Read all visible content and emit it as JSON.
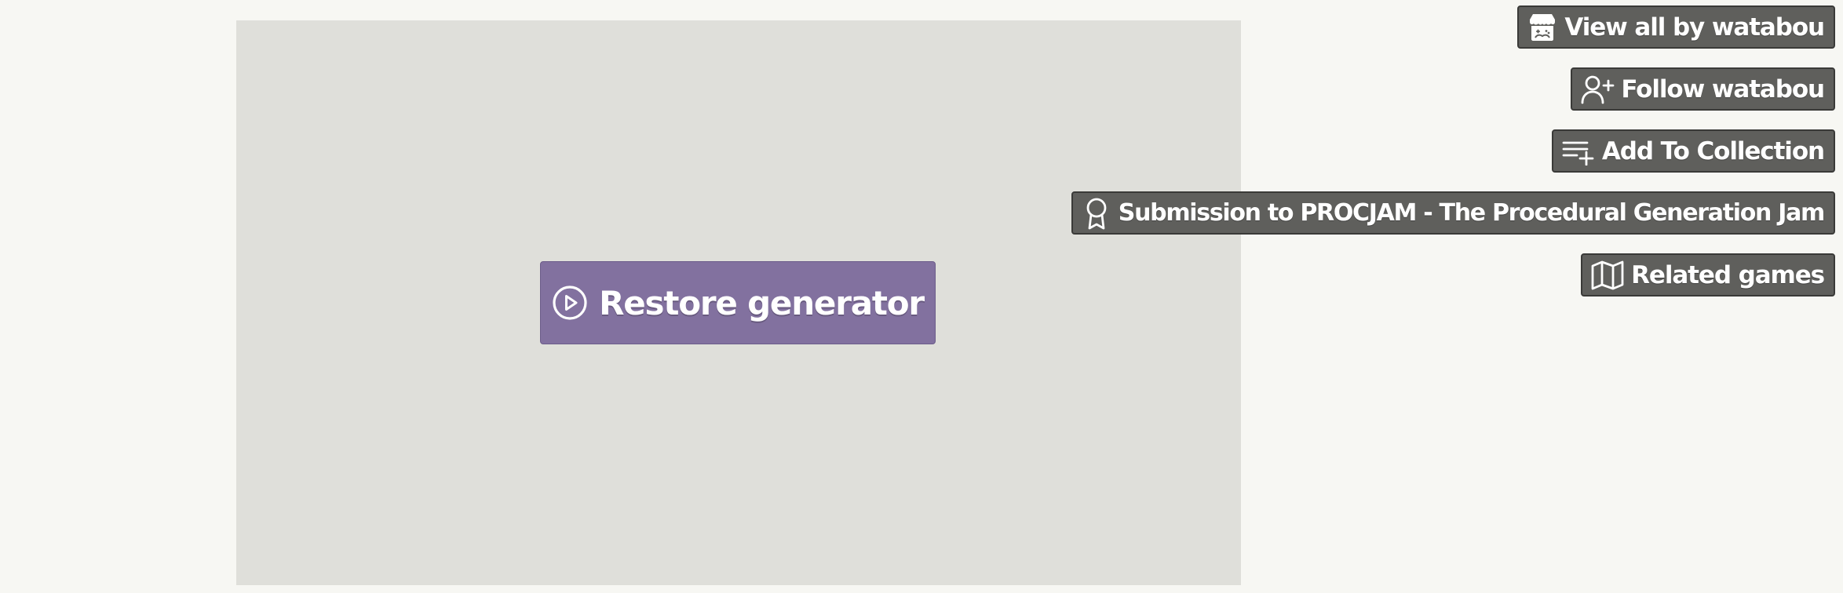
{
  "game": {
    "play_button_label": "Restore generator",
    "play_button_icon": "play-circle-icon",
    "frame_color": "#dfdfda",
    "button_color": "#82719f"
  },
  "sidebar": {
    "view_all_label": "View all by watabou",
    "view_all_icon": "store-icon",
    "follow_label": "Follow watabou",
    "follow_icon": "user-plus-icon",
    "collection_label": "Add To Collection",
    "collection_icon": "playlist-add-icon",
    "submission_label": "Submission to PROCJAM - The Procedural Generation Jam",
    "submission_icon": "award-icon",
    "related_label": "Related games",
    "related_icon": "map-icon",
    "button_color": "#5f5f5c"
  }
}
